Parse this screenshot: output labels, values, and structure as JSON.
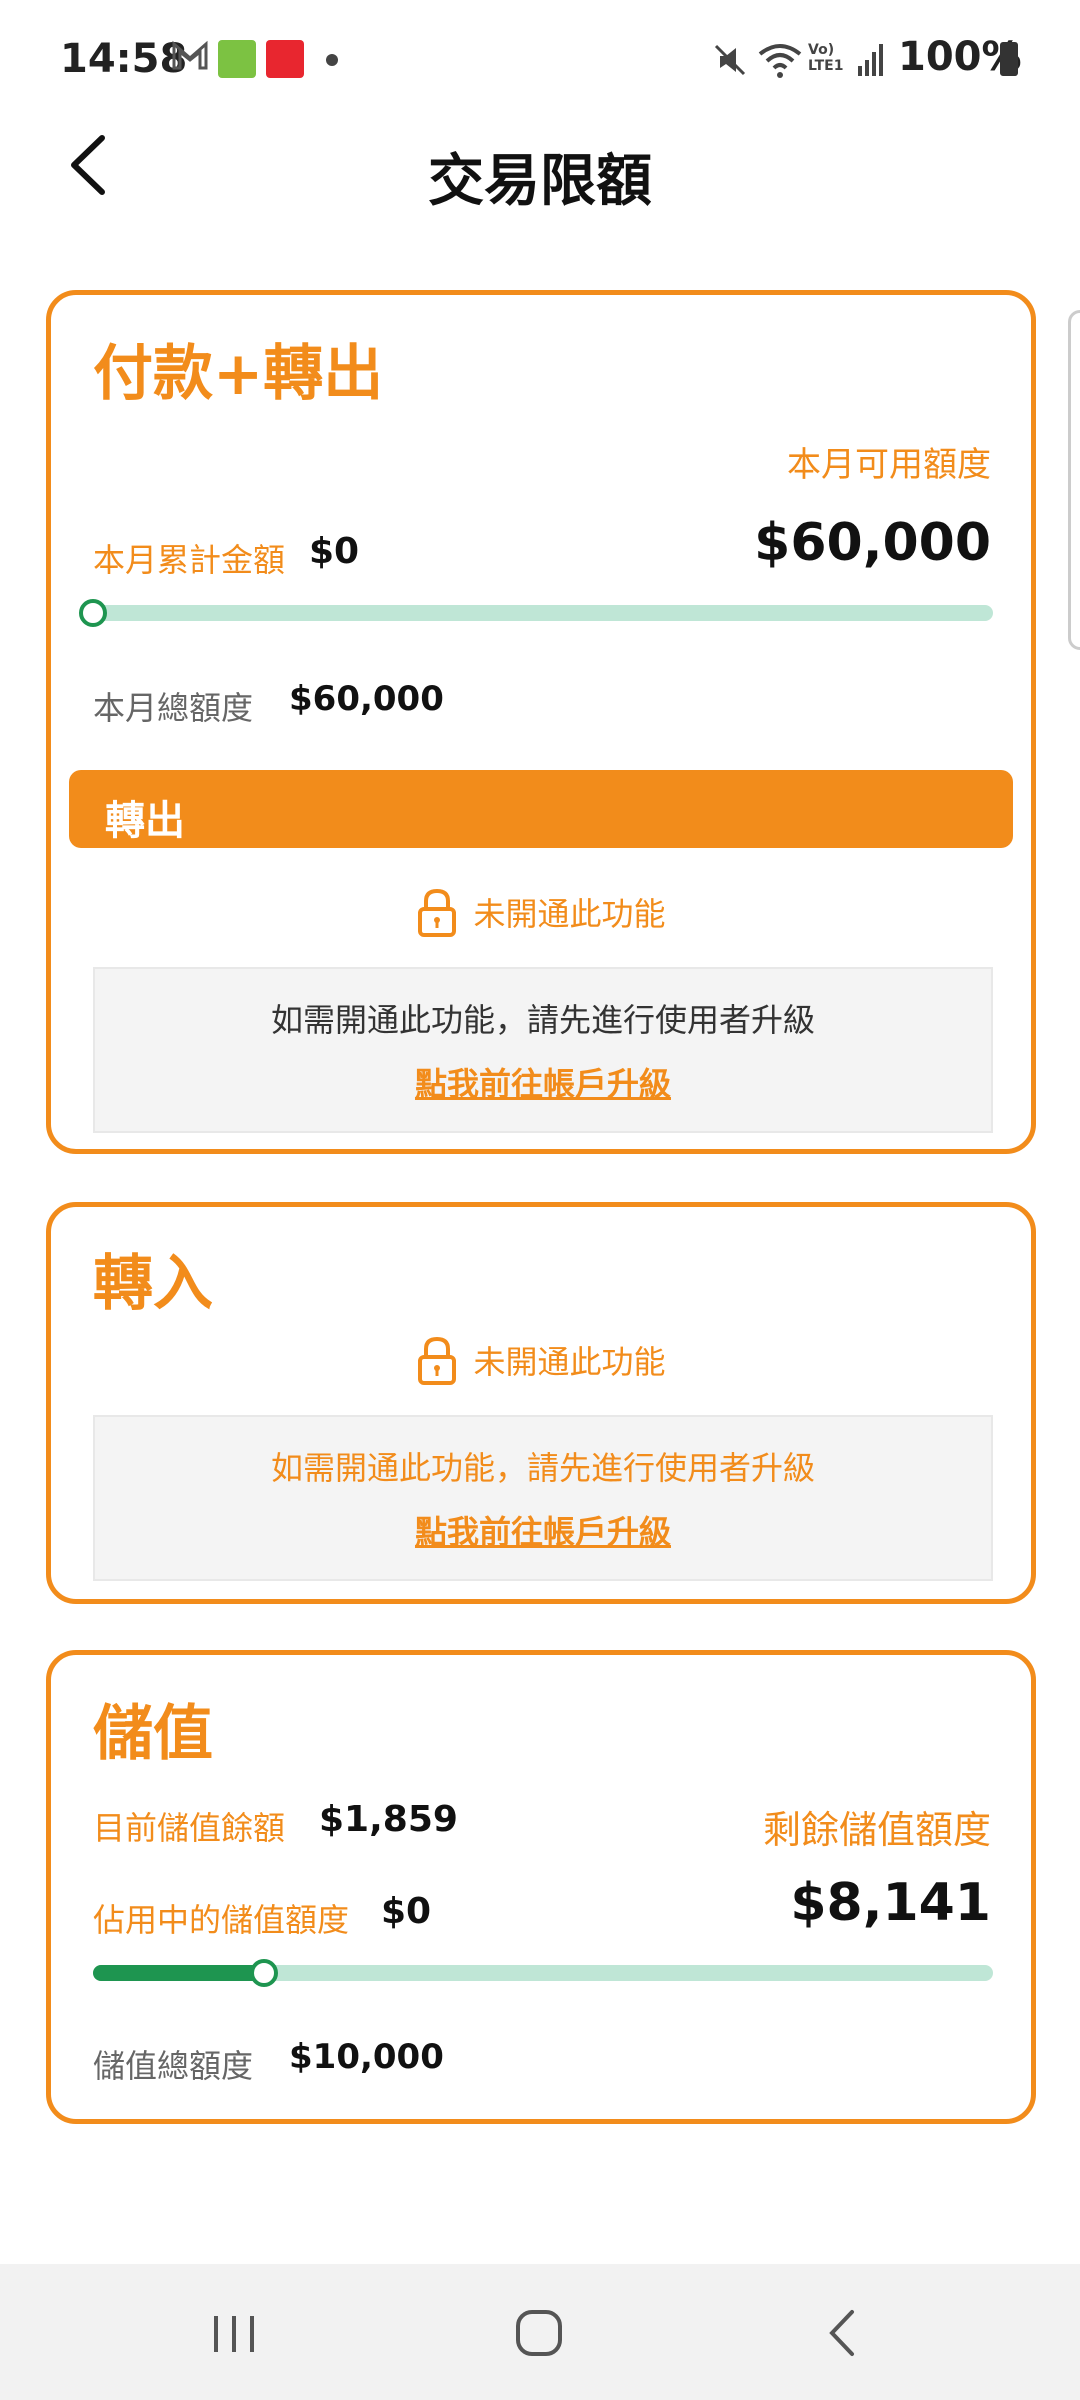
{
  "status": {
    "time": "14:58",
    "battery": "100%"
  },
  "header": {
    "title": "交易限額"
  },
  "payment": {
    "title": "付款+轉出",
    "available_label": "本月可用額度",
    "available_value": "$60,000",
    "accum_label": "本月累計金額",
    "accum_value": "$0",
    "progress": 0,
    "total_label": "本月總額度",
    "total_value": "$60,000",
    "sub_title": "轉出",
    "locked_label": "未開通此功能",
    "locked_msg": "如需開通此功能，請先進行使用者升級",
    "upgrade_link": "點我前往帳戶升級"
  },
  "transfer_in": {
    "title": "轉入",
    "locked_label": "未開通此功能",
    "locked_msg": "如需開通此功能，請先進行使用者升級",
    "upgrade_link": "點我前往帳戶升級"
  },
  "stored_value": {
    "title": "儲值",
    "balance_label": "目前儲值餘額",
    "balance_value": "$1,859",
    "remaining_label": "剩餘儲值額度",
    "remaining_value": "$8,141",
    "occupied_label": "佔用中的儲值額度",
    "occupied_value": "$0",
    "progress": 0.19,
    "total_label": "儲值總額度",
    "total_value": "$10,000"
  },
  "colors": {
    "accent": "#F28C1B",
    "progress": "#1E9550",
    "track": "#BFE6D6"
  }
}
